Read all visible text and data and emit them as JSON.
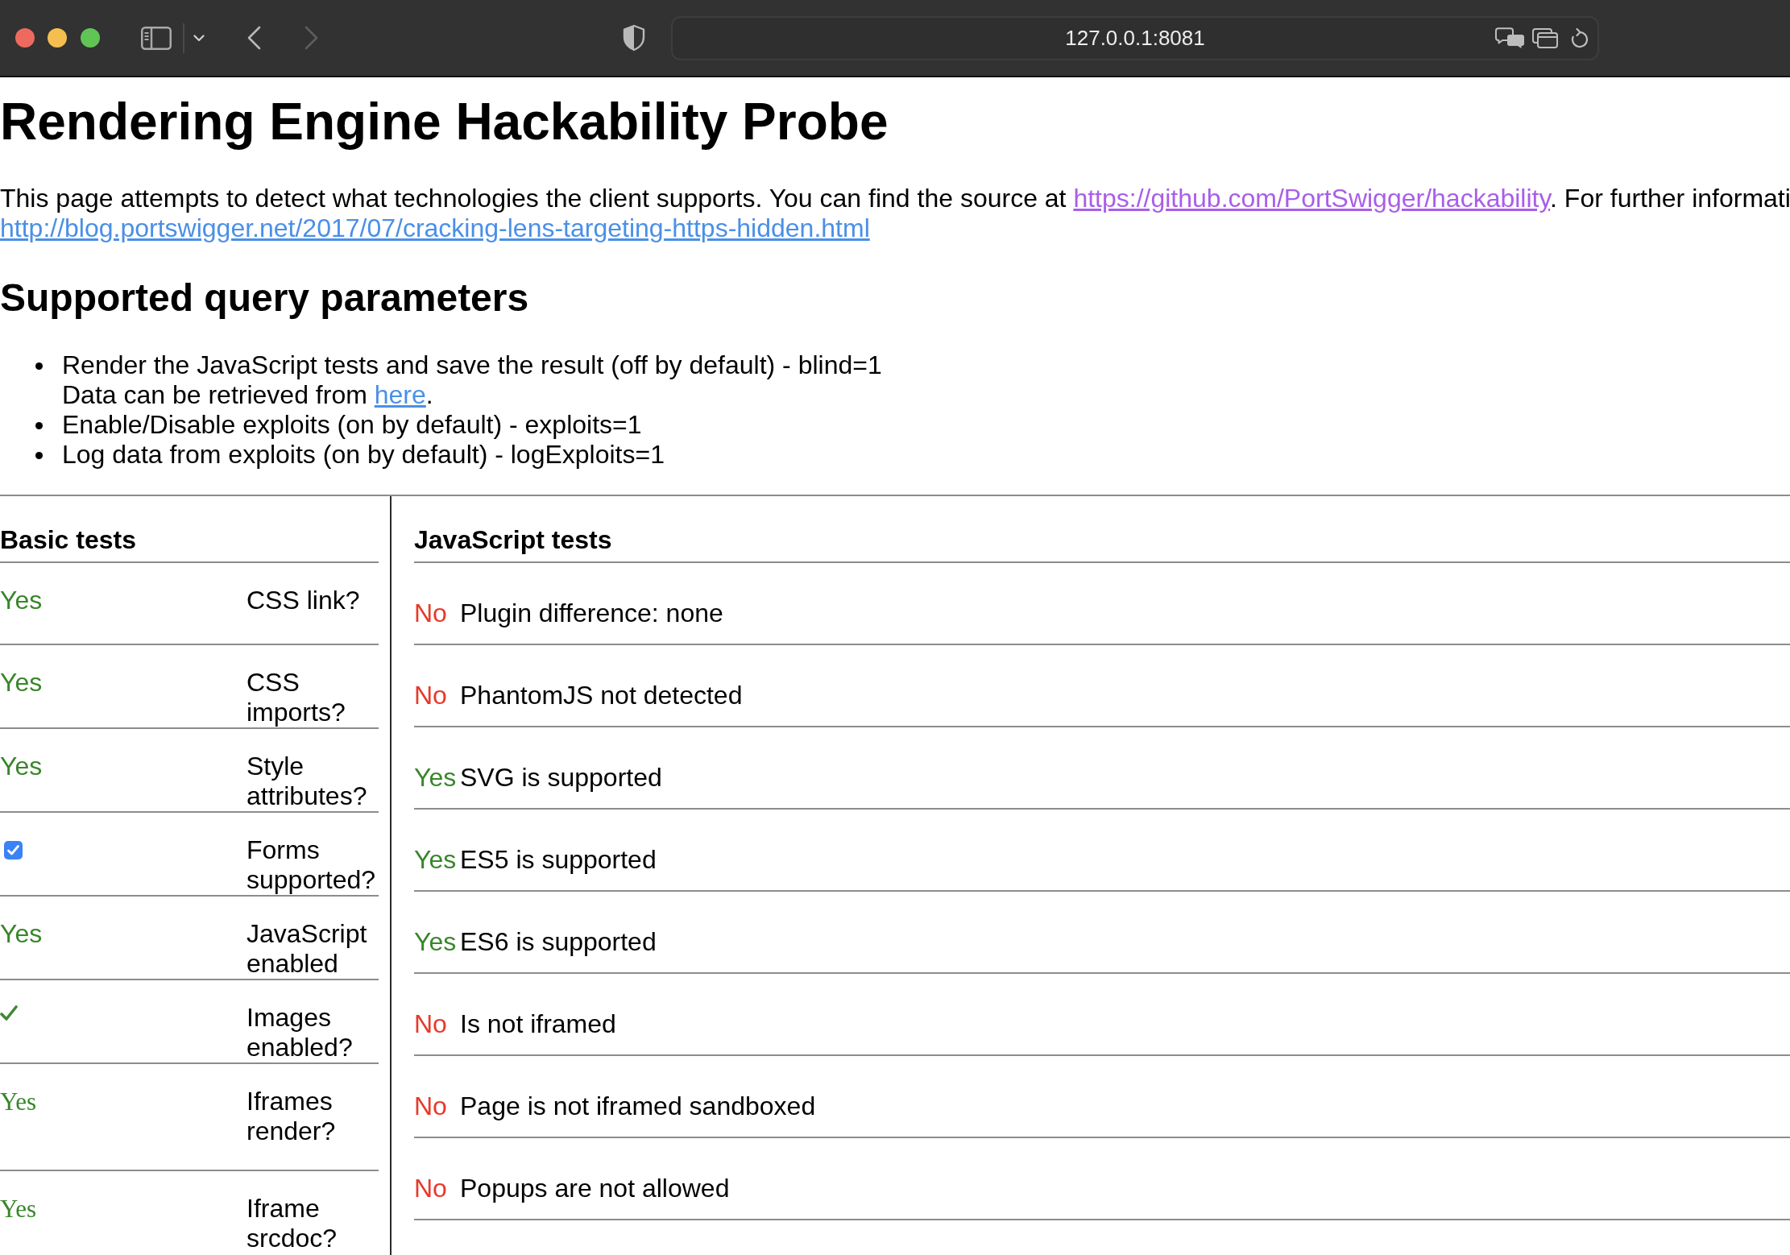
{
  "browser": {
    "url": "127.0.0.1:8081",
    "back": {
      "disabled": false
    },
    "forward": {
      "disabled": true
    }
  },
  "title": "Rendering Engine Hackability Probe",
  "intro": {
    "parts": [
      {
        "kind": "text",
        "text": "This page attempts to detect what technologies the client supports. You can find the source at "
      },
      {
        "kind": "link",
        "text": "https://github.com/PortSwigger/hackability",
        "visited": true
      },
      {
        "kind": "text",
        "text": ". For further informati"
      },
      {
        "kind": "break"
      },
      {
        "kind": "link",
        "text": "http://blog.portswigger.net/2017/07/cracking-lens-targeting-https-hidden.html",
        "visited": false
      }
    ]
  },
  "query_parameters": {
    "heading": "Supported query parameters",
    "items": [
      {
        "parts": [
          {
            "kind": "text",
            "text": "Render the JavaScript tests and save the result (off by default) - blind=1"
          },
          {
            "kind": "break"
          },
          {
            "kind": "text",
            "text": "Data can be retrieved from "
          },
          {
            "kind": "link",
            "text": "here",
            "visited": false
          },
          {
            "kind": "text",
            "text": "."
          }
        ]
      },
      {
        "parts": [
          {
            "kind": "text",
            "text": "Enable/Disable exploits (on by default) - exploits=1"
          }
        ]
      },
      {
        "parts": [
          {
            "kind": "text",
            "text": "Log data from exploits (on by default) - logExploits=1"
          }
        ]
      }
    ]
  },
  "basic_tests": {
    "heading": "Basic tests",
    "rows": [
      {
        "kind": "text",
        "result": "Yes",
        "passed": true,
        "label": "CSS link?"
      },
      {
        "kind": "text",
        "result": "Yes",
        "passed": true,
        "label": "CSS imports?"
      },
      {
        "kind": "text",
        "result": "Yes",
        "passed": true,
        "label": "Style attributes?"
      },
      {
        "kind": "checkbox",
        "checked": true,
        "label": "Forms supported?"
      },
      {
        "kind": "text",
        "result": "Yes",
        "passed": true,
        "label": "JavaScript enabled"
      },
      {
        "kind": "image",
        "label": "Images enabled?"
      },
      {
        "kind": "frame",
        "result": "Yes",
        "passed": true,
        "label": "Iframes render?"
      },
      {
        "kind": "frame",
        "result": "Yes",
        "passed": true,
        "label": "Iframe srcdoc?"
      }
    ]
  },
  "javascript_tests": {
    "heading": "JavaScript tests",
    "rows": [
      {
        "result": "No",
        "passed": false,
        "label": "Plugin difference: none"
      },
      {
        "result": "No",
        "passed": false,
        "label": "PhantomJS not detected"
      },
      {
        "result": "Yes",
        "passed": true,
        "label": "SVG is supported"
      },
      {
        "result": "Yes",
        "passed": true,
        "label": "ES5 is supported"
      },
      {
        "result": "Yes",
        "passed": true,
        "label": "ES6 is supported"
      },
      {
        "result": "No",
        "passed": false,
        "label": "Is not iframed"
      },
      {
        "result": "No",
        "passed": false,
        "label": "Page is not iframed sandboxed"
      },
      {
        "result": "No",
        "passed": false,
        "label": "Popups are not allowed"
      }
    ]
  }
}
